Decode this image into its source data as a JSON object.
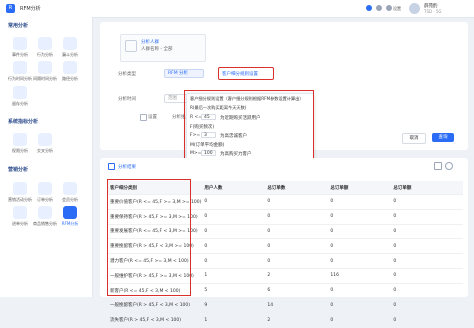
{
  "app": {
    "logo_text": "R",
    "title": "RFM分析",
    "user_name": "薛苑酌",
    "user_role": "TSD · 5G",
    "lang": "设置"
  },
  "sidebar": {
    "sections": [
      {
        "title": "常用分析",
        "items": [
          {
            "label": "事件分析",
            "icon": "event-icon"
          },
          {
            "label": "行为分析",
            "icon": "behavior-icon"
          },
          {
            "label": "漏斗分析",
            "icon": "funnel-icon"
          },
          {
            "label": "行为时间分析",
            "icon": "time-icon"
          },
          {
            "label": "间隔时间分析",
            "icon": "interval-icon"
          },
          {
            "label": "路径分析",
            "icon": "path-icon"
          },
          {
            "label": "留存分析",
            "icon": "retention-icon"
          }
        ]
      },
      {
        "title": "系统指标分析",
        "items": [
          {
            "label": "权限分析",
            "icon": "permission-icon"
          },
          {
            "label": "交叉分析",
            "icon": "cross-icon"
          }
        ]
      },
      {
        "title": "营销分析",
        "items": [
          {
            "label": "营销活动分析",
            "icon": "marketing-icon"
          },
          {
            "label": "订单分析",
            "icon": "order-icon"
          },
          {
            "label": "会员分析",
            "icon": "member-icon"
          },
          {
            "label": "进单分析",
            "icon": "entry-icon"
          },
          {
            "label": "商品销售分析",
            "icon": "sales-icon"
          },
          {
            "label": "RFM分析",
            "icon": "rfm-icon"
          }
        ]
      }
    ]
  },
  "analysis_object": {
    "title": "分析人群",
    "desc": "人群名称 - 全部"
  },
  "form": {
    "model_label": "分析类型",
    "model_value": "RFM 分析",
    "custom_label": "客户细分规则设置",
    "time_label": "分析时间",
    "range_label": "范围",
    "checkbox_label": "设置",
    "dimension_label": "分析维度"
  },
  "popup": {
    "title": "客户细分规则设置（客户细分规则根据RFM参数设置计算出）",
    "subtitle": "R(最后一次购买距离今天天数)",
    "r_prefix": "R <=",
    "r_value": "45",
    "r_note": "为近期购买活跃用户",
    "f_label": "F(购买频次)",
    "f_prefix": "F>=",
    "f_value": "3",
    "f_note": "为高忠诚客户",
    "m_label": "M(订单平均金额)",
    "m_prefix": "M>=",
    "m_value": "100",
    "m_note": "为高购买力客户"
  },
  "buttons": {
    "cancel": "取消",
    "confirm": "查询"
  },
  "results": {
    "title": "分析结果",
    "columns": [
      "客户细分类别",
      "用户人数",
      "总订单数",
      "总订单额",
      "总订单额"
    ],
    "rows": [
      [
        "重要价值客户(R <= 45,F >= 3,M >= 100)",
        "0",
        "0",
        "0",
        "0"
      ],
      [
        "重要保持客户(R > 45,F >= 3,M >= 100)",
        "0",
        "0",
        "0",
        "0"
      ],
      [
        "重要发展客户(R <= 45,F < 3,M >= 100)",
        "0",
        "0",
        "0",
        "0"
      ],
      [
        "重要挽留客户(R > 45,F < 3,M >= 100)",
        "0",
        "0",
        "0",
        "0"
      ],
      [
        "潜力客户(R <= 45,F >= 3,M < 100)",
        "0",
        "0",
        "0",
        "0"
      ],
      [
        "一般维护客户(R > 45,F >= 3,M < 100)",
        "1",
        "2",
        "116",
        "0"
      ],
      [
        "新客户(R <= 45,F < 3,M < 100)",
        "5",
        "6",
        "0",
        "0"
      ],
      [
        "一般挽留客户(R > 45,F < 3,M < 100)",
        "9",
        "14",
        "0",
        "0"
      ],
      [
        "流失客户(R > 45,F < 3,M < 100)",
        "1",
        "2",
        "0",
        "0"
      ]
    ]
  },
  "colors": {
    "accent": "#2b6cf6",
    "highlight": "#d9302b"
  }
}
